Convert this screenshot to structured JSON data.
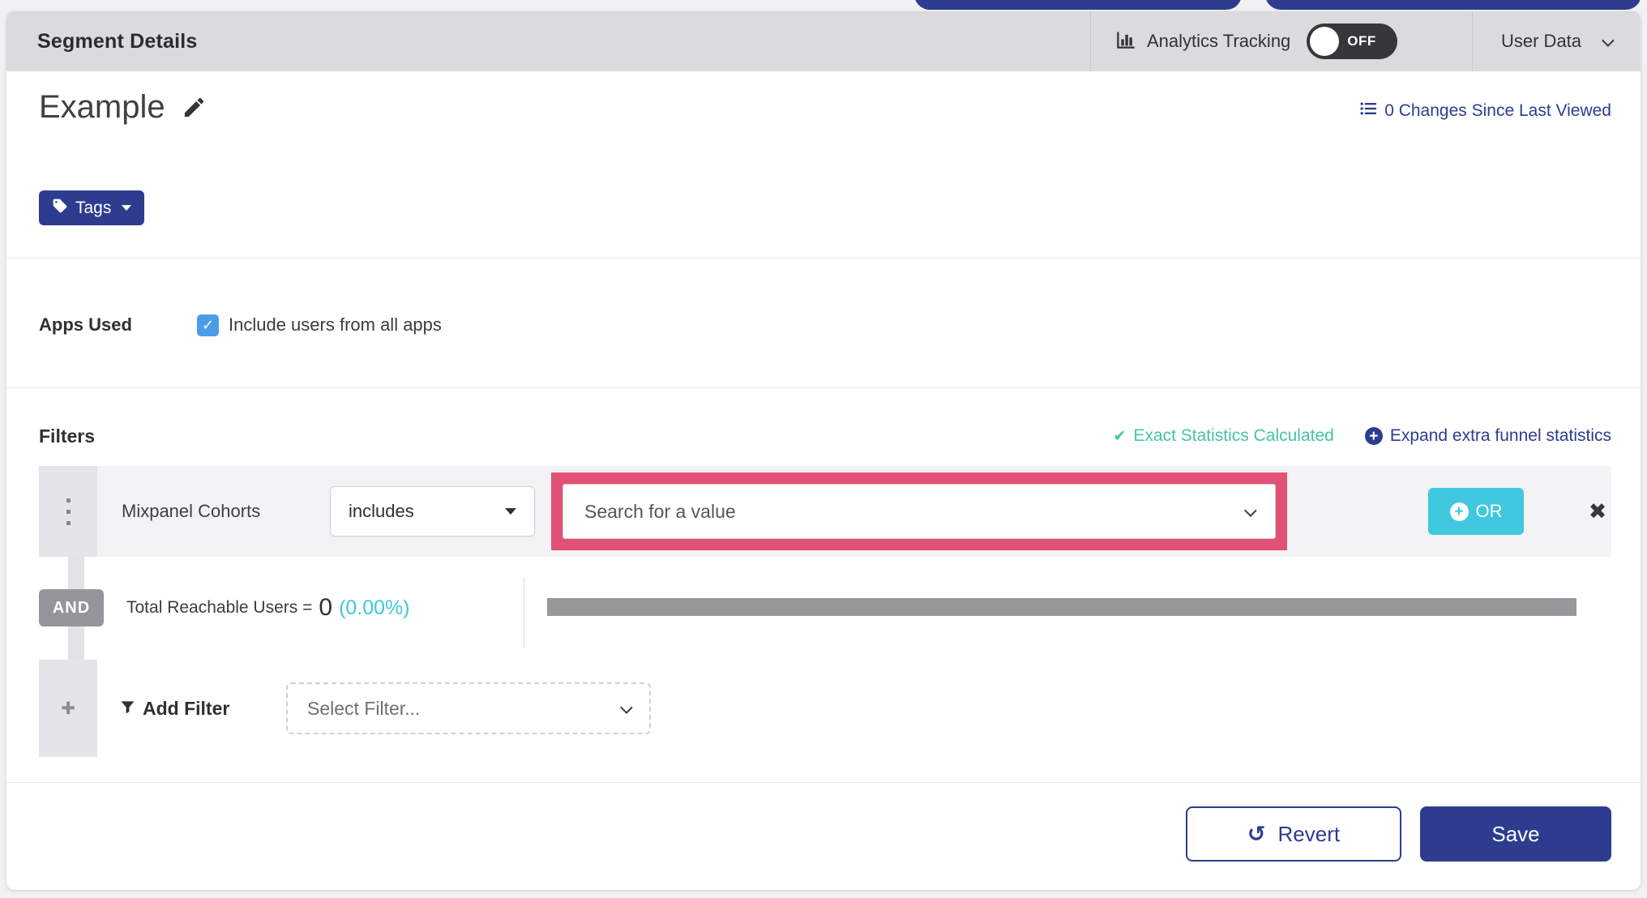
{
  "header": {
    "title": "Segment Details",
    "analytics_tracking": "Analytics Tracking",
    "analytics_toggle": "OFF",
    "user_data": "User Data"
  },
  "segment": {
    "name": "Example",
    "tags_button": "Tags",
    "changes_link": "0 Changes Since Last Viewed"
  },
  "apps_used": {
    "label": "Apps Used",
    "include_all": "Include users from all apps",
    "checked": true
  },
  "filters": {
    "heading": "Filters",
    "exact_statistics": "Exact Statistics Calculated",
    "expand_funnel": "Expand extra funnel statistics",
    "row": {
      "field": "Mixpanel Cohorts",
      "operator": "includes",
      "value_placeholder": "Search for a value",
      "or_button": "OR"
    },
    "conjunction": "AND",
    "total_reachable_label": "Total Reachable Users =",
    "total_reachable_value": "0",
    "total_reachable_percent": "(0.00%)",
    "add_filter_label": "Add Filter",
    "select_filter_placeholder": "Select Filter..."
  },
  "footer": {
    "revert": "Revert",
    "save": "Save"
  },
  "icons": {
    "green_check": "✔",
    "close": "✖",
    "revert_arrow": "↺",
    "checkbox_check": "✓",
    "plus": "+",
    "add_plus": "✚"
  },
  "colors": {
    "brand_blue": "#2d3c8f",
    "teal": "#3fc8de",
    "green": "#45c4a3",
    "highlight_pink": "#e25075",
    "toggle_dark": "#37373a",
    "checkbox_blue": "#4a9ee9",
    "bar_gray": "#98989c",
    "and_badge_gray": "#96969a"
  }
}
